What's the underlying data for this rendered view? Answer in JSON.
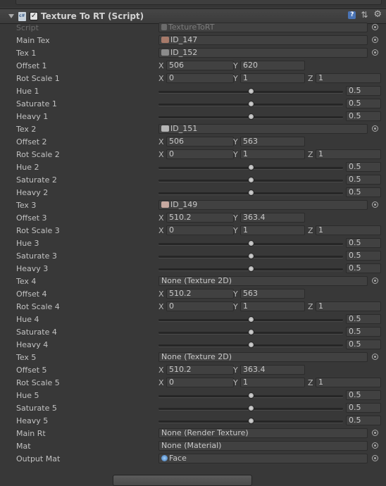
{
  "component": {
    "title": "Texture To RT (Script)"
  },
  "script": {
    "label": "Script",
    "value": "TextureToRT"
  },
  "axes": {
    "x": "X",
    "y": "Y",
    "z": "Z"
  },
  "main_tex": {
    "label": "Main Tex",
    "value": "ID_147"
  },
  "groups": [
    {
      "tex_label": "Tex 1",
      "tex_value": "ID_152",
      "thumb": "#8b8b8b",
      "offset_label": "Offset 1",
      "offset_x": "506",
      "offset_y": "620",
      "rot_label": "Rot Scale 1",
      "rot_x": "0",
      "rot_y": "1",
      "rot_z": "1",
      "hue_label": "Hue 1",
      "hue": "0.5",
      "sat_label": "Saturate 1",
      "sat": "0.5",
      "heavy_label": "Heavy 1",
      "heavy": "0.5"
    },
    {
      "tex_label": "Tex 2",
      "tex_value": "ID_151",
      "thumb": "#b5b5b5",
      "offset_label": "Offset 2",
      "offset_x": "506",
      "offset_y": "563",
      "rot_label": "Rot Scale 2",
      "rot_x": "0",
      "rot_y": "1",
      "rot_z": "1",
      "hue_label": "Hue 2",
      "hue": "0.5",
      "sat_label": "Saturate 2",
      "sat": "0.5",
      "heavy_label": "Heavy 2",
      "heavy": "0.5"
    },
    {
      "tex_label": "Tex 3",
      "tex_value": "ID_149",
      "thumb": "#c7a9a0",
      "offset_label": "Offset 3",
      "offset_x": "510.2",
      "offset_y": "363.4",
      "rot_label": "Rot Scale 3",
      "rot_x": "0",
      "rot_y": "1",
      "rot_z": "1",
      "hue_label": "Hue 3",
      "hue": "0.5",
      "sat_label": "Saturate 3",
      "sat": "0.5",
      "heavy_label": "Heavy 3",
      "heavy": "0.5"
    },
    {
      "tex_label": "Tex 4",
      "tex_value": "None (Texture 2D)",
      "thumb": "",
      "offset_label": "Offset 4",
      "offset_x": "510.2",
      "offset_y": "563",
      "rot_label": "Rot Scale 4",
      "rot_x": "0",
      "rot_y": "1",
      "rot_z": "1",
      "hue_label": "Hue 4",
      "hue": "0.5",
      "sat_label": "Saturate 4",
      "sat": "0.5",
      "heavy_label": "Heavy 4",
      "heavy": "0.5"
    },
    {
      "tex_label": "Tex 5",
      "tex_value": "None (Texture 2D)",
      "thumb": "",
      "offset_label": "Offset 5",
      "offset_x": "510.2",
      "offset_y": "363.4",
      "rot_label": "Rot Scale 5",
      "rot_x": "0",
      "rot_y": "1",
      "rot_z": "1",
      "hue_label": "Hue 5",
      "hue": "0.5",
      "sat_label": "Saturate 5",
      "sat": "0.5",
      "heavy_label": "Heavy 5",
      "heavy": "0.5"
    }
  ],
  "main_rt": {
    "label": "Main Rt",
    "value": "None (Render Texture)"
  },
  "mat": {
    "label": "Mat",
    "value": "None (Material)"
  },
  "output_mat": {
    "label": "Output Mat",
    "value": "Face"
  },
  "slider_fraction": 0.5,
  "colors": {
    "accent": "#4a74b5",
    "panel": "#383838",
    "field": "#414141"
  }
}
